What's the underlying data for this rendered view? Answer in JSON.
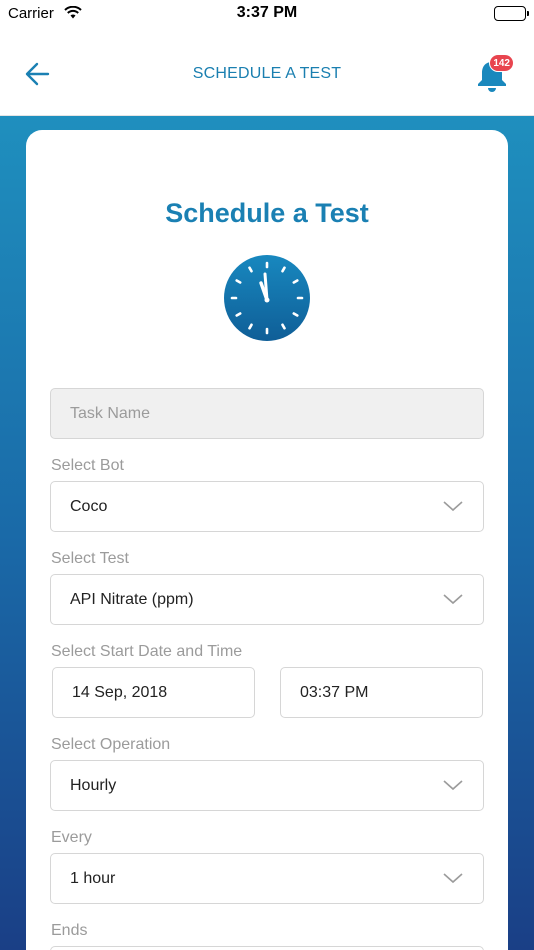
{
  "status": {
    "carrier": "Carrier",
    "time": "3:37 PM"
  },
  "nav": {
    "title": "SCHEDULE A TEST",
    "badge_count": "142"
  },
  "form": {
    "heading": "Schedule a Test",
    "task_name_placeholder": "Task Name",
    "select_bot_label": "Select Bot",
    "select_bot_value": "Coco",
    "select_test_label": "Select Test",
    "select_test_value": "API Nitrate (ppm)",
    "start_label": "Select Start Date and Time",
    "start_date": "14 Sep, 2018",
    "start_time": "03:37 PM",
    "operation_label": "Select Operation",
    "operation_value": "Hourly",
    "every_label": "Every",
    "every_value": "1 hour",
    "ends_label": "Ends"
  },
  "colors": {
    "accent": "#1a80b3",
    "badge": "#e8454f",
    "gradient_top": "#1f8fbe",
    "gradient_bottom": "#1a3f86"
  },
  "icons": {
    "back": "arrow-left-icon",
    "notifications": "bell-icon",
    "clock": "clock-icon",
    "dropdown": "chevron-down-icon"
  }
}
